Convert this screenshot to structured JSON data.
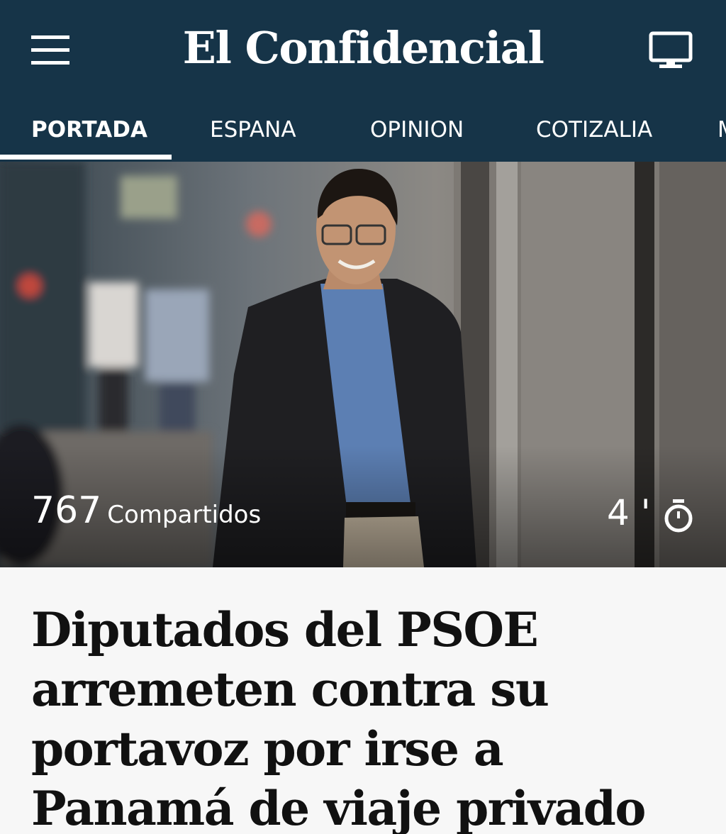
{
  "header": {
    "brand": "El Confidencial",
    "menu_icon": "hamburger-menu-icon",
    "tv_icon": "tv-monitor-icon",
    "background_color": "#163448"
  },
  "nav": {
    "tabs": [
      {
        "label": "PORTADA",
        "active": true
      },
      {
        "label": "ESPANA",
        "active": false
      },
      {
        "label": "OPINION",
        "active": false
      },
      {
        "label": "COTIZALIA",
        "active": false
      },
      {
        "label": "M",
        "active": false
      }
    ]
  },
  "article": {
    "image_alt": "Hombre sonriente con gafas, chaqueta oscura y camisa azul caminando por una calle",
    "shares_count": "767",
    "shares_label": "Compartidos",
    "read_time": "4 '",
    "read_time_icon": "stopwatch-icon",
    "headline": "Diputados del PSOE arremeten contra su portavoz por irse a Panamá de viaje privado"
  }
}
